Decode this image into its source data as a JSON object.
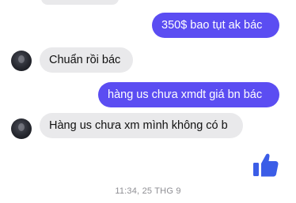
{
  "colors": {
    "outgoing_bubble": "#5b4df2",
    "incoming_bubble": "#e9e9eb",
    "like_icon": "#3b5de7",
    "timestamp_text": "#8e8e93"
  },
  "messages": [
    {
      "direction": "outgoing",
      "text": "350$ bao tụt ak bác"
    },
    {
      "direction": "incoming",
      "text": "Chuẩn rồi bác"
    },
    {
      "direction": "outgoing",
      "text": "hàng us chưa xmdt giá bn bác"
    },
    {
      "direction": "incoming",
      "text": "Hàng us chưa xm mình không có b"
    }
  ],
  "timestamp": "11:34, 25 THG 9",
  "icons": {
    "like": "thumbs-up-icon",
    "avatar": "contact-avatar"
  }
}
